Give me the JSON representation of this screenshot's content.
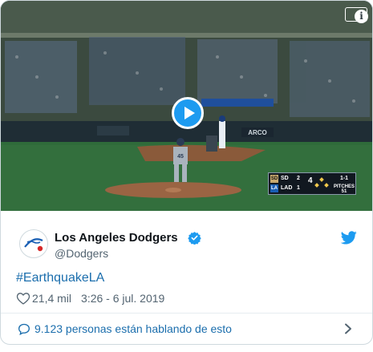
{
  "media": {
    "scoreboard": {
      "away_abbr": "SD",
      "away_score": "2",
      "home_abbr": "LAD",
      "home_score": "1",
      "inning": "4",
      "count": "1-1",
      "pitches_label": "PITCHES",
      "pitches": "51"
    },
    "jersey_number": "45",
    "ad_board": "ARCO"
  },
  "tweet": {
    "display_name": "Los Angeles Dodgers",
    "handle": "@Dodgers",
    "text": "#EarthquakeLA",
    "likes": "21,4 mil",
    "timestamp": "3:26 - 6 jul. 2019"
  },
  "footer": {
    "conversation_label": "9.123 personas están hablando de esto"
  },
  "colors": {
    "link": "#1b6ead",
    "twitter_blue": "#1d9bf0",
    "text_primary": "#0f1419",
    "text_secondary": "#536471"
  },
  "icons": [
    "info-icon",
    "play-icon",
    "verified-icon",
    "twitter-bird-icon",
    "heart-icon",
    "chat-bubble-icon",
    "chevron-right-icon"
  ]
}
